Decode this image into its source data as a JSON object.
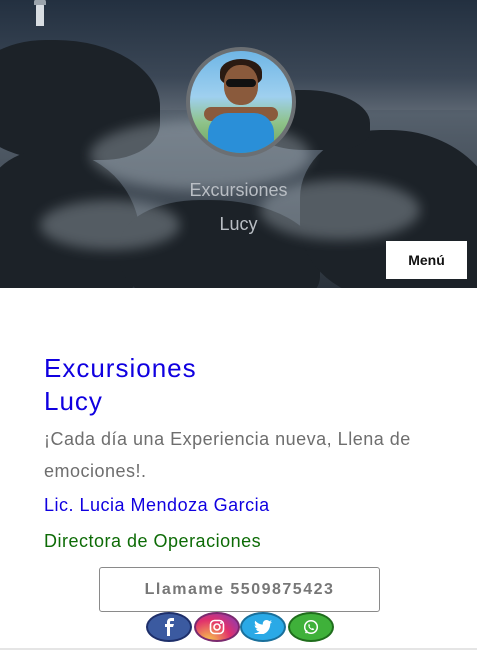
{
  "header": {
    "site_title_line1": "Excursiones",
    "site_title_line2": "Lucy",
    "menu_label": "Menú"
  },
  "main": {
    "title_line1": "Excursiones",
    "title_line2": "Lucy",
    "tagline": "¡Cada día una Experiencia nueva, Llena de emociones!.",
    "person_name": "Lic. Lucia Mendoza Garcia",
    "person_role": "Directora de Operaciones",
    "call_button_label": "Llamame 5509875423"
  },
  "social": [
    {
      "name": "facebook",
      "icon": "facebook-icon"
    },
    {
      "name": "instagram",
      "icon": "instagram-icon"
    },
    {
      "name": "twitter",
      "icon": "twitter-icon"
    },
    {
      "name": "whatsapp",
      "icon": "whatsapp-icon"
    }
  ],
  "colors": {
    "title_blue": "#1000e0",
    "role_green": "#0d6b06",
    "text_gray": "#6e6e6e"
  }
}
